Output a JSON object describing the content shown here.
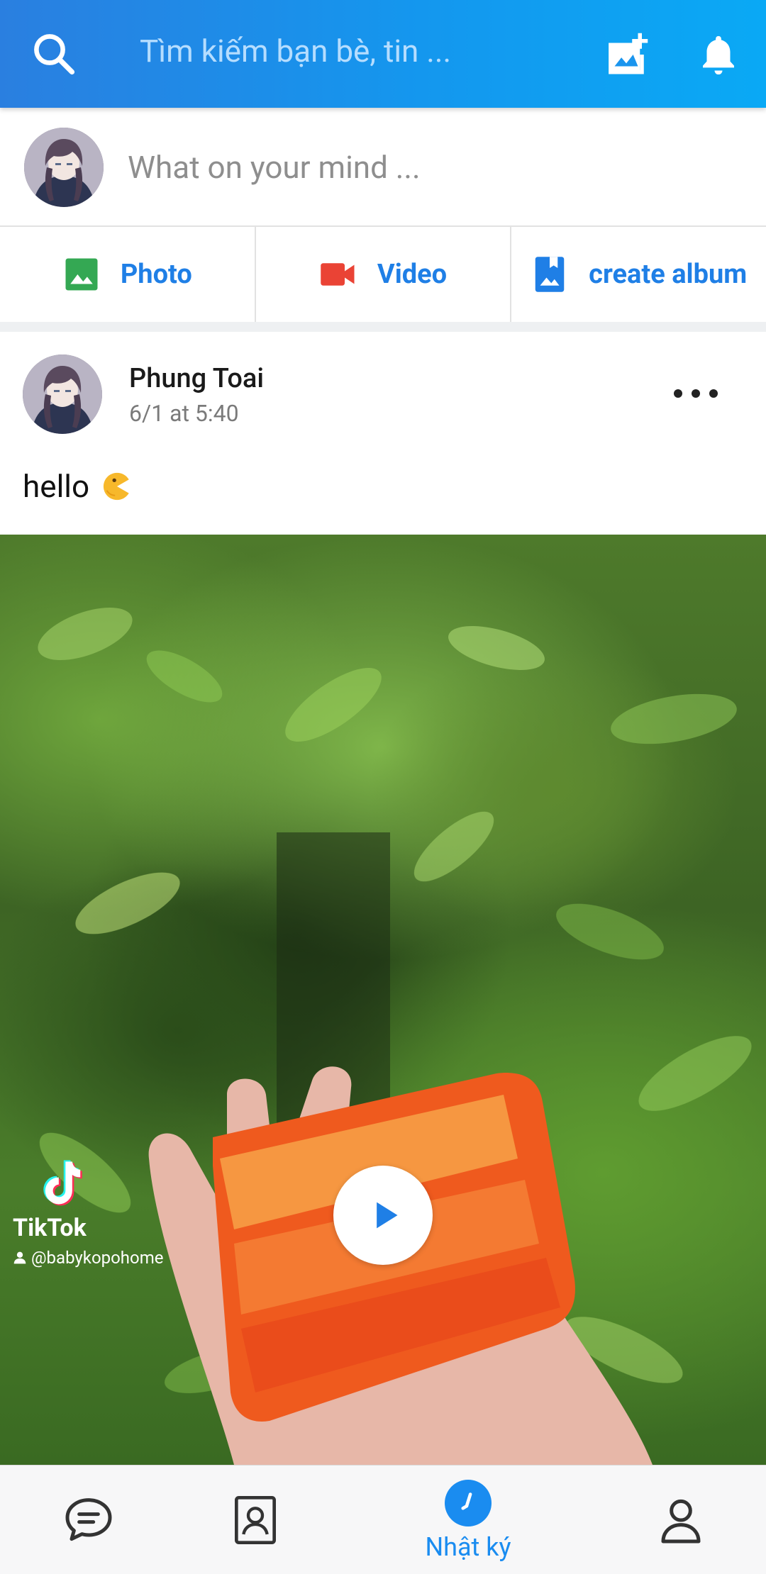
{
  "header": {
    "search_placeholder": "Tìm kiếm bạn bè, tin ..."
  },
  "composer": {
    "prompt": "What on your mind ..."
  },
  "media_actions": [
    {
      "label": "Photo"
    },
    {
      "label": "Video"
    },
    {
      "label": "create album"
    }
  ],
  "post": {
    "author": "Phung Toai",
    "time": "6/1 at 5:40",
    "text": "hello",
    "video": {
      "watermark_brand": "TikTok",
      "watermark_handle": "@babykopohome"
    }
  },
  "bottom_nav": {
    "diary_label": "Nhật ký"
  },
  "colors": {
    "header_start": "#2a7fe0",
    "header_end": "#0aa9f5",
    "accent_blue": "#1f7fe6",
    "photo_green": "#34a853",
    "video_red": "#ea4335"
  }
}
